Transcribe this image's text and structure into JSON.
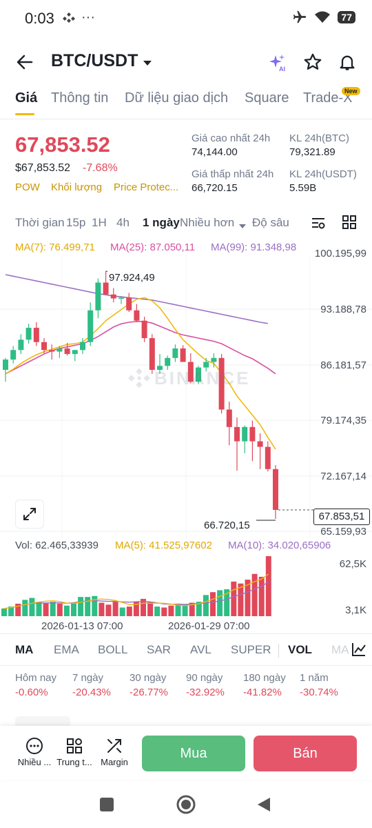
{
  "status": {
    "time": "0:03",
    "battery": "77"
  },
  "header": {
    "pair": "BTC/USDT"
  },
  "tabs": [
    {
      "label": "Giá"
    },
    {
      "label": "Thông tin"
    },
    {
      "label": "Dữ liệu giao dịch"
    },
    {
      "label": "Square"
    },
    {
      "label": "Trade-X",
      "badge": "New"
    }
  ],
  "price": {
    "last": "67,853.52",
    "usd": "$67,853.52",
    "change": "-7.68%",
    "tags": [
      "POW",
      "Khối lượng",
      "Price Protec..."
    ]
  },
  "stats": {
    "high_label": "Giá cao nhất 24h",
    "high": "74,144.00",
    "low_label": "Giá thấp nhất 24h",
    "low": "66,720.15",
    "vol_btc_label": "KL 24h(BTC)",
    "vol_btc": "79,321.89",
    "vol_usdt_label": "KL 24h(USDT)",
    "vol_usdt": "5.59B"
  },
  "intervals": [
    "Thời gian",
    "15p",
    "1H",
    "4h",
    "1 ngày",
    "Nhiều hơn",
    "Độ sâu"
  ],
  "ma": {
    "ma7": "MA(7): 76.499,71",
    "ma25": "MA(25): 87.050,11",
    "ma99": "MA(99): 91.348,98"
  },
  "axis": [
    "100.195,99",
    "93.188,78",
    "86.181,57",
    "79.174,35",
    "72.167,14",
    "65.159,93"
  ],
  "annotations": {
    "high": "97.924,49",
    "low": "66.720,15",
    "current": "67.853,51"
  },
  "watermark": "BINANCE",
  "volume": {
    "vol": "Vol: 62.465,33939",
    "ma5": "MA(5): 41.525,97602",
    "ma10": "MA(10): 34.020,65906",
    "axis_top": "62,5K",
    "axis_bottom": "3,1K"
  },
  "dates": [
    "2026-01-13 07:00",
    "2026-01-29 07:00"
  ],
  "indicators": [
    "MA",
    "EMA",
    "BOLL",
    "SAR",
    "AVL",
    "SUPER",
    "VOL",
    "MA"
  ],
  "performance": [
    {
      "label": "Hôm nay",
      "value": "-0.60%"
    },
    {
      "label": "7 ngày",
      "value": "-20.43%"
    },
    {
      "label": "30 ngày",
      "value": "-26.77%"
    },
    {
      "label": "90 ngày",
      "value": "-32.92%"
    },
    {
      "label": "180 ngày",
      "value": "-41.82%"
    },
    {
      "label": "1 năm",
      "value": "-30.74%"
    }
  ],
  "actions": {
    "more": "Nhiều ...",
    "center": "Trung t...",
    "margin": "Margin",
    "buy": "Mua",
    "sell": "Bán"
  },
  "colors": {
    "up": "#2ebd85",
    "down": "#e0485a",
    "ma7": "#f0b90b",
    "ma25": "#d84fa0",
    "ma99": "#9b6fc4",
    "accent": "#f0b90b"
  },
  "chart_data": {
    "type": "candlestick",
    "ylim": [
      65159.93,
      100195.99
    ],
    "candles": [
      {
        "o": 85500,
        "h": 87000,
        "l": 84000,
        "c": 86800
      },
      {
        "o": 86800,
        "h": 88500,
        "l": 86300,
        "c": 88000
      },
      {
        "o": 88000,
        "h": 90000,
        "l": 87500,
        "c": 89300
      },
      {
        "o": 89300,
        "h": 91300,
        "l": 88800,
        "c": 90800
      },
      {
        "o": 90800,
        "h": 91500,
        "l": 88500,
        "c": 89000
      },
      {
        "o": 89000,
        "h": 89500,
        "l": 87600,
        "c": 88000
      },
      {
        "o": 88000,
        "h": 88700,
        "l": 86800,
        "c": 87800
      },
      {
        "o": 87800,
        "h": 88500,
        "l": 87000,
        "c": 88200
      },
      {
        "o": 88200,
        "h": 88900,
        "l": 87300,
        "c": 87500
      },
      {
        "o": 87500,
        "h": 88000,
        "l": 86600,
        "c": 88000
      },
      {
        "o": 88000,
        "h": 89500,
        "l": 87500,
        "c": 89000
      },
      {
        "o": 89000,
        "h": 94000,
        "l": 88500,
        "c": 93000
      },
      {
        "o": 93000,
        "h": 97000,
        "l": 92000,
        "c": 96500
      },
      {
        "o": 96500,
        "h": 97924.49,
        "l": 95500,
        "c": 95000
      },
      {
        "o": 95000,
        "h": 95800,
        "l": 94000,
        "c": 94500
      },
      {
        "o": 94500,
        "h": 94800,
        "l": 93800,
        "c": 94600
      },
      {
        "o": 94600,
        "h": 95200,
        "l": 92800,
        "c": 93000
      },
      {
        "o": 93000,
        "h": 93800,
        "l": 91500,
        "c": 91700
      },
      {
        "o": 91700,
        "h": 92200,
        "l": 89000,
        "c": 89500
      },
      {
        "o": 89500,
        "h": 90000,
        "l": 85000,
        "c": 85500
      },
      {
        "o": 85500,
        "h": 87500,
        "l": 85000,
        "c": 86000
      },
      {
        "o": 86000,
        "h": 87300,
        "l": 85500,
        "c": 87000
      },
      {
        "o": 87000,
        "h": 88700,
        "l": 86500,
        "c": 88200
      },
      {
        "o": 88200,
        "h": 88600,
        "l": 86800,
        "c": 86500
      },
      {
        "o": 86500,
        "h": 87600,
        "l": 83800,
        "c": 84000
      },
      {
        "o": 84000,
        "h": 86000,
        "l": 83700,
        "c": 85800
      },
      {
        "o": 85800,
        "h": 87000,
        "l": 85300,
        "c": 86500
      },
      {
        "o": 86500,
        "h": 87600,
        "l": 85800,
        "c": 87000
      },
      {
        "o": 87000,
        "h": 87500,
        "l": 80000,
        "c": 80500
      },
      {
        "o": 80500,
        "h": 81500,
        "l": 76000,
        "c": 78300
      },
      {
        "o": 78300,
        "h": 79500,
        "l": 72800,
        "c": 76500
      },
      {
        "o": 76500,
        "h": 78500,
        "l": 75000,
        "c": 78300
      },
      {
        "o": 78300,
        "h": 79100,
        "l": 74000,
        "c": 76500
      },
      {
        "o": 76500,
        "h": 77500,
        "l": 73000,
        "c": 75800
      },
      {
        "o": 75800,
        "h": 76500,
        "l": 72700,
        "c": 73000
      },
      {
        "o": 73000,
        "h": 73500,
        "l": 66720.15,
        "c": 67853.51
      }
    ],
    "ma7": [
      85000,
      85600,
      86300,
      86900,
      87400,
      87800,
      88100,
      88400,
      88700,
      88800,
      89000,
      89800,
      90700,
      91700,
      92400,
      93100,
      93800,
      94400,
      94600,
      94200,
      93300,
      92000,
      90600,
      89300,
      88400,
      87500,
      86700,
      86300,
      85100,
      83800,
      82200,
      81000,
      79800,
      78600,
      77000,
      75500
    ],
    "ma25": [
      85000,
      85500,
      86000,
      86500,
      87000,
      87500,
      87900,
      88200,
      88400,
      88600,
      88800,
      89200,
      89700,
      90300,
      90900,
      91300,
      91500,
      91600,
      91600,
      91400,
      91000,
      90600,
      90200,
      89900,
      89700,
      89500,
      89300,
      89100,
      88800,
      88300,
      87800,
      87300,
      86900,
      86300,
      85700,
      85000
    ],
    "ma99": [
      97500,
      97300,
      97100,
      96900,
      96700,
      96500,
      96300,
      96100,
      95900,
      95700,
      95500,
      95300,
      95100,
      94950,
      94800,
      94700,
      94600,
      94500,
      94400,
      94300,
      94100,
      93900,
      93700,
      93500,
      93300,
      93100,
      92900,
      92700,
      92500,
      92300,
      92100,
      91900,
      91700,
      91500,
      91350
    ],
    "volumes": [
      8000,
      10000,
      13000,
      17000,
      19000,
      15000,
      14000,
      15000,
      13000,
      11000,
      14000,
      20000,
      20000,
      21000,
      14000,
      12000,
      15000,
      9000,
      10000,
      15000,
      18000,
      15000,
      10000,
      9000,
      11000,
      13000,
      12000,
      14000,
      15000,
      22000,
      25000,
      27000,
      28000,
      36000,
      34000,
      38000,
      44000,
      41000,
      62465
    ],
    "vol_max": 62500
  }
}
